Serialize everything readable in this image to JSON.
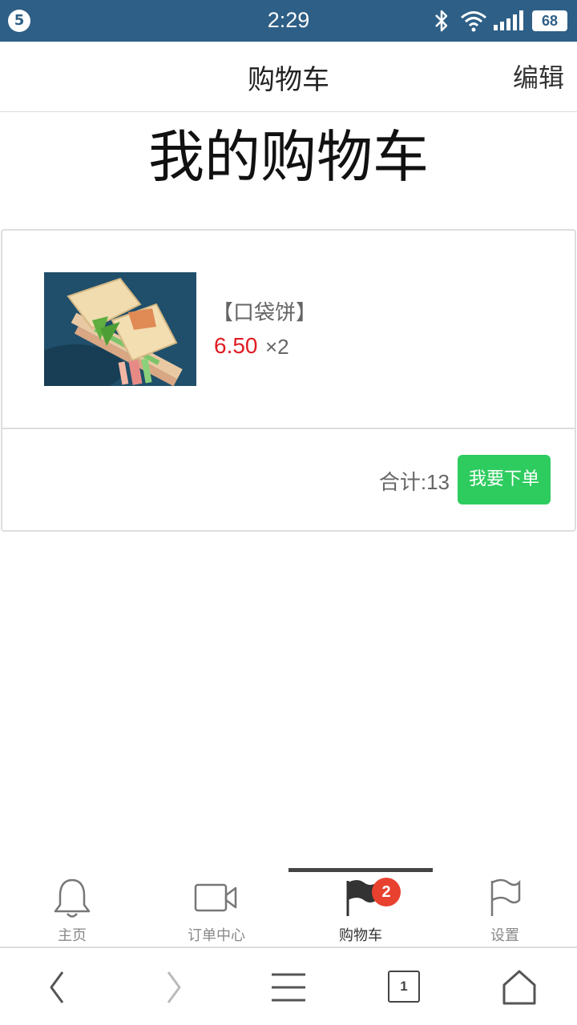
{
  "status_bar": {
    "notification_count": "5",
    "time": "2:29",
    "battery": "68"
  },
  "header": {
    "title": "购物车",
    "edit_label": "编辑"
  },
  "page": {
    "heading": "我的购物车"
  },
  "cart": {
    "item": {
      "name": "【口袋饼】",
      "price": "6.50",
      "quantity": "×2"
    },
    "total": "合计:13",
    "order_button": "我要下单"
  },
  "tabbar": {
    "tabs": [
      {
        "label": "主页",
        "icon": "bell-icon"
      },
      {
        "label": "订单中心",
        "icon": "video-camera-icon"
      },
      {
        "label": "购物车",
        "icon": "flag-filled-icon",
        "badge": "2",
        "active": true
      },
      {
        "label": "设置",
        "icon": "flag-outline-icon"
      }
    ]
  },
  "browser": {
    "tab_count": "1"
  },
  "colors": {
    "status_bar": "#2e5f86",
    "price": "#e01b22",
    "order_button": "#2ecc5f",
    "badge": "#e8412f"
  }
}
